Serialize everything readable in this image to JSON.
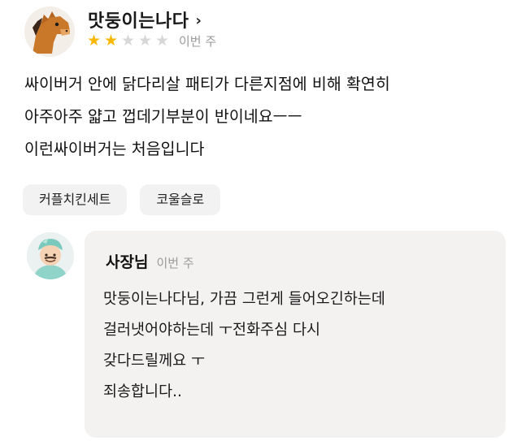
{
  "review": {
    "reviewer_name": "맛둥이는나다",
    "rating": 2,
    "max_rating": 5,
    "time": "이번 주",
    "body_lines": [
      "싸이버거 안에 닭다리살 패티가 다른지점에 비해 확연히",
      "아주아주 얇고 껍데기부분이 반이네요ㅡㅡ",
      "이런싸이버거는 처음입니다"
    ],
    "menu_tags": [
      "커플치킨세트",
      "코울슬로"
    ]
  },
  "owner_reply": {
    "name": "사장님",
    "time": "이번 주",
    "lines": [
      "맛둥이는나다님, 가끔 그런게 들어오긴하는데",
      "걸러냇어야하는데 ㅜ전화주심 다시",
      "갖다드릴께요 ㅜ",
      "죄송합니다.."
    ]
  },
  "colors": {
    "star_filled": "#f9b700",
    "star_empty": "#d7d7d7",
    "reply_bubble": "#f4f2f1",
    "tag_background": "#f2f2f2",
    "muted_text": "#9a9a9a"
  },
  "icons": {
    "reviewer_avatar": "horse-avatar-icon",
    "owner_avatar": "chef-avatar-icon",
    "name_chevron": "chevron-right-icon",
    "rating_star": "star-icon"
  }
}
